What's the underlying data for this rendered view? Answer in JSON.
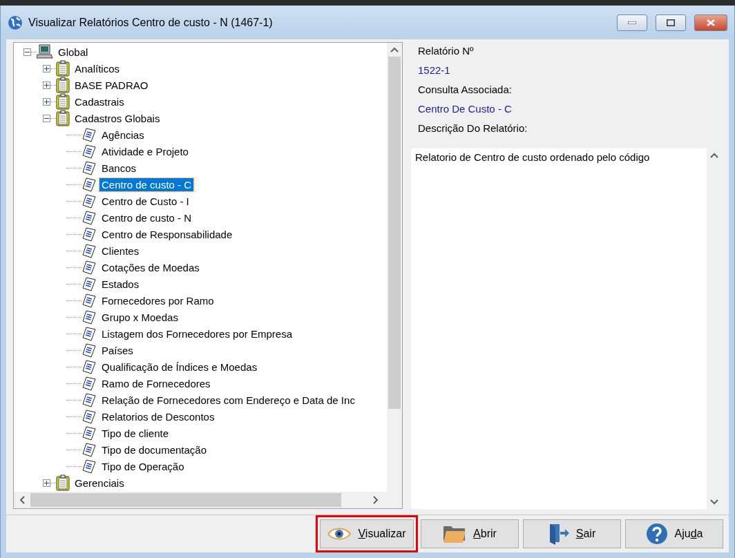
{
  "window": {
    "title": "Visualizar Relatórios Centro de custo - N (1467-1)"
  },
  "tree": [
    {
      "label": "Global",
      "kind": "computer",
      "expanded": true,
      "selected": false,
      "children": [
        {
          "label": "Analíticos",
          "kind": "folder",
          "expanded": false,
          "selected": false
        },
        {
          "label": "BASE PADRAO",
          "kind": "folder",
          "expanded": false,
          "selected": false
        },
        {
          "label": "Cadastrais",
          "kind": "folder",
          "expanded": false,
          "selected": false
        },
        {
          "label": "Cadastros Globais",
          "kind": "folder",
          "expanded": true,
          "selected": false,
          "children": [
            {
              "label": "Agências",
              "kind": "report",
              "selected": false
            },
            {
              "label": "Atividade e Projeto",
              "kind": "report",
              "selected": false
            },
            {
              "label": "Bancos",
              "kind": "report",
              "selected": false
            },
            {
              "label": "Centro de custo - C",
              "kind": "report",
              "selected": true
            },
            {
              "label": "Centro de Custo - I",
              "kind": "report",
              "selected": false
            },
            {
              "label": "Centro de custo - N",
              "kind": "report",
              "selected": false
            },
            {
              "label": "Centro de Responsabilidade",
              "kind": "report",
              "selected": false
            },
            {
              "label": "Clientes",
              "kind": "report",
              "selected": false
            },
            {
              "label": "Cotações de Moedas",
              "kind": "report",
              "selected": false
            },
            {
              "label": "Estados",
              "kind": "report",
              "selected": false
            },
            {
              "label": "Fornecedores por Ramo",
              "kind": "report",
              "selected": false
            },
            {
              "label": "Grupo x Moedas",
              "kind": "report",
              "selected": false
            },
            {
              "label": "Listagem dos Fornecedores por Empresa",
              "kind": "report",
              "selected": false
            },
            {
              "label": "Países",
              "kind": "report",
              "selected": false
            },
            {
              "label": "Qualificação de Índices e Moedas",
              "kind": "report",
              "selected": false
            },
            {
              "label": "Ramo de Fornecedores",
              "kind": "report",
              "selected": false
            },
            {
              "label": "Relação de Fornecedores com Endereço e Data de Inc",
              "kind": "report",
              "selected": false
            },
            {
              "label": "Relatorios de Descontos",
              "kind": "report",
              "selected": false
            },
            {
              "label": "Tipo de cliente",
              "kind": "report",
              "selected": false
            },
            {
              "label": "Tipo de documentação",
              "kind": "report",
              "selected": false
            },
            {
              "label": "Tipo de Operação",
              "kind": "report",
              "selected": false
            }
          ]
        },
        {
          "label": "Gerenciais",
          "kind": "folder",
          "expanded": false,
          "selected": false
        }
      ]
    }
  ],
  "details": {
    "report_number_label": "Relatório Nº",
    "report_number": "1522-1",
    "query_label": "Consulta Associada:",
    "query": "Centro De Custo - C",
    "description_label": "Descrição Do Relatório:",
    "description": "Relatorio de Centro de custo ordenado pelo código"
  },
  "buttons": [
    {
      "kind": "view",
      "access_key": "V",
      "label_rest": "isualizar",
      "highlighted": true
    },
    {
      "kind": "open",
      "access_key": "A",
      "label_rest": "brir",
      "highlighted": false
    },
    {
      "kind": "exit",
      "access_key": "S",
      "label_rest": "air",
      "highlighted": false
    },
    {
      "kind": "help",
      "label_start": "Aju",
      "access_key": "d",
      "label_rest": "a",
      "highlighted": false
    }
  ]
}
